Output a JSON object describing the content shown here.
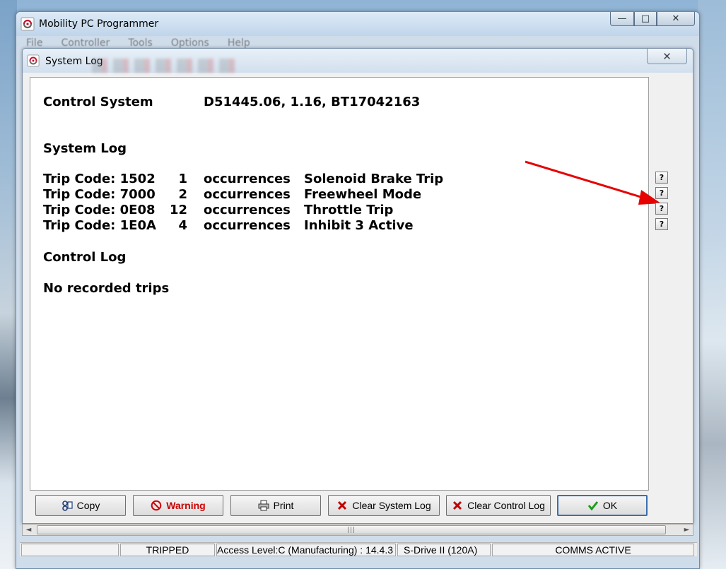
{
  "app": {
    "title": "Mobility PC Programmer",
    "menu": [
      "File",
      "Controller",
      "Tools",
      "Options",
      "Help"
    ]
  },
  "dialog": {
    "title": "System Log",
    "control_system": {
      "label": "Control System",
      "value": "D51445.06, 1.16, BT17042163"
    },
    "system_log_heading": "System Log",
    "trips": [
      {
        "code": "Trip Code: 1502",
        "count": "1",
        "occ": "occurrences",
        "desc": "Solenoid Brake Trip"
      },
      {
        "code": "Trip Code: 7000",
        "count": "2",
        "occ": "occurrences",
        "desc": "Freewheel Mode"
      },
      {
        "code": "Trip Code: 0E08",
        "count": "12",
        "occ": "occurrences",
        "desc": "Throttle Trip"
      },
      {
        "code": "Trip Code: 1E0A",
        "count": "4",
        "occ": "occurrences",
        "desc": "Inhibit 3 Active"
      }
    ],
    "help_label": "?",
    "control_log_heading": "Control Log",
    "control_log_text": "No recorded trips",
    "buttons": {
      "copy": "Copy",
      "warning": "Warning",
      "print": "Print",
      "clear_system": "Clear System Log",
      "clear_control": "Clear Control Log",
      "ok": "OK"
    }
  },
  "statusbar": {
    "state": "TRIPPED",
    "access": "Access Level:C (Manufacturing) : 14.4.3",
    "drive": "S-Drive II (120A)",
    "comms": "COMMS ACTIVE"
  },
  "colors": {
    "warning": "#cc0000",
    "annotation_arrow": "#e60000",
    "ok_check": "#1f9a1f",
    "clear_x": "#c00000"
  },
  "icons": {
    "close": "close-icon",
    "help": "question-mark-icon",
    "copy": "copy-icon",
    "warning": "no-entry-icon",
    "print": "printer-icon",
    "clear": "red-x-icon",
    "ok": "checkmark-icon"
  }
}
